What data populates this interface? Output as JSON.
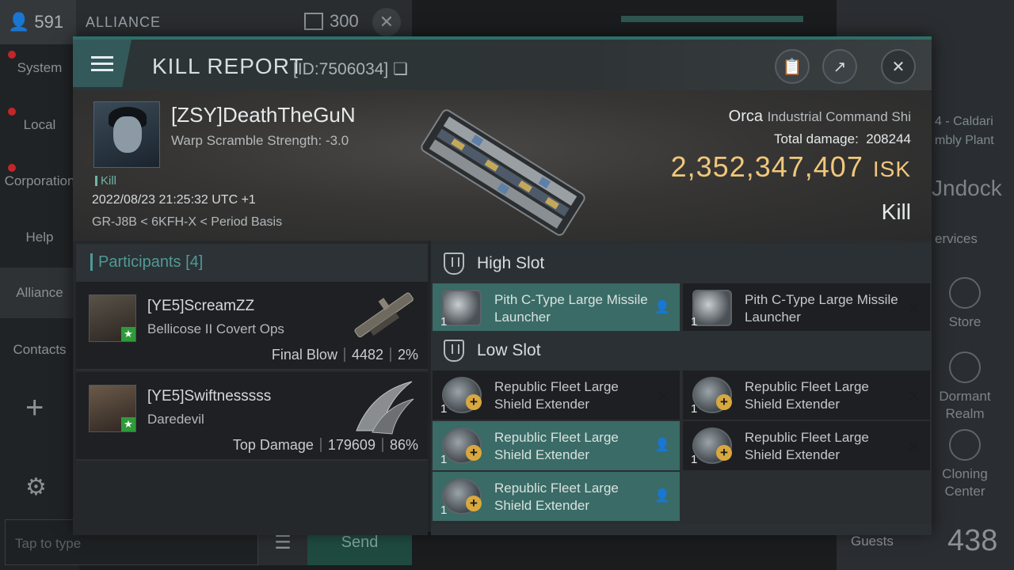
{
  "background": {
    "user_count": "591",
    "chat_channel": "ALLIANCE",
    "chat_capacity": "300",
    "nav_items": [
      "System",
      "Local",
      "Corporation",
      "Help",
      "Alliance",
      "Contacts"
    ],
    "chat_placeholder": "Tap to type",
    "send_label": "Send",
    "location_line1": "4 - Caldari",
    "location_line2": "mbly Plant",
    "undock_label": "Jndock",
    "services_label": "ervices",
    "store_label": "Store",
    "dormant_realm_label": "Dormant Realm",
    "cloning_center_label": "Cloning Center",
    "guests_label": "Guests",
    "guests_count": "438"
  },
  "modal": {
    "title": "KILL REPORT",
    "report_id": "[ID:7506034]",
    "victim": {
      "name": "[ZSY]DeathTheGuN",
      "warp_scramble": "Warp Scramble Strength: -3.0",
      "tag": "Kill",
      "datetime": "2022/08/23 21:25:32 UTC +1",
      "location": "GR-J8B < 6KFH-X < Period Basis"
    },
    "ship": {
      "name": "Orca",
      "class": "Industrial Command Shi",
      "total_damage_label": "Total damage:",
      "total_damage": "208244",
      "isk_value": "2,352,347,407",
      "isk_unit": "ISK",
      "result": "Kill"
    },
    "participants": {
      "label": "Participants",
      "count": "[4]",
      "rows": [
        {
          "name": "[YE5]ScreamZZ",
          "ship": "Bellicose II Covert Ops",
          "role": "Final Blow",
          "damage": "4482",
          "percent": "2%"
        },
        {
          "name": "[YE5]Swiftnesssss",
          "ship": "Daredevil",
          "role": "Top Damage",
          "damage": "179609",
          "percent": "86%"
        }
      ]
    },
    "high_slot": {
      "label": "High Slot",
      "modules": [
        {
          "name": "Pith C-Type Large Missile Launcher",
          "qty": "1",
          "status": "dropped"
        },
        {
          "name": "Pith C-Type Large Missile Launcher",
          "qty": "1",
          "status": "destroyed"
        }
      ]
    },
    "low_slot": {
      "label": "Low Slot",
      "modules": [
        {
          "name": "Republic Fleet Large Shield Extender",
          "qty": "1",
          "status": "destroyed"
        },
        {
          "name": "Republic Fleet Large Shield Extender",
          "qty": "1",
          "status": "destroyed"
        },
        {
          "name": "Republic Fleet Large Shield Extender",
          "qty": "1",
          "status": "dropped"
        },
        {
          "name": "Republic Fleet Large Shield Extender",
          "qty": "1",
          "status": "destroyed"
        },
        {
          "name": "Republic Fleet Large Shield Extender",
          "qty": "1",
          "status": "dropped"
        }
      ]
    },
    "colors": {
      "accent": "#2c6f6a",
      "isk": "#f0c77a",
      "highlight_row": "#3a6b66"
    }
  }
}
